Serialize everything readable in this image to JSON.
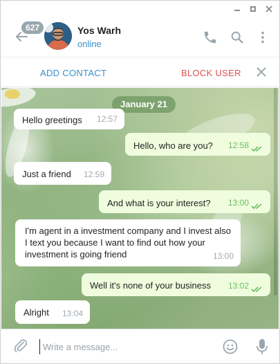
{
  "window": {
    "controls": [
      "minimize",
      "maximize",
      "close"
    ]
  },
  "header": {
    "unread_count": "627",
    "peer_name": "Yos Warh",
    "peer_status": "online",
    "icons": [
      "back-arrow-icon",
      "phone-icon",
      "search-icon",
      "more-vertical-icon"
    ]
  },
  "actions": {
    "add_contact": "ADD CONTACT",
    "block_user": "BLOCK USER"
  },
  "chat": {
    "date": "January 21",
    "messages": [
      {
        "dir": "in",
        "text": "Hello greetings",
        "time": "12:57"
      },
      {
        "dir": "out",
        "text": "Hello, who are you?",
        "time": "12:58",
        "read": true
      },
      {
        "dir": "in",
        "text": "Just a friend",
        "time": "12:59"
      },
      {
        "dir": "out",
        "text": "And what is your interest?",
        "time": "13:00",
        "read": true
      },
      {
        "dir": "in",
        "text": "I'm agent in a investment company and I invest also I text you because I want to find out how your investment is going friend",
        "time": "13:00"
      },
      {
        "dir": "out",
        "text": "Well it's none of your business",
        "time": "13:02",
        "read": true
      },
      {
        "dir": "in",
        "text": "Alright",
        "time": "13:04"
      }
    ]
  },
  "composer": {
    "placeholder": "Write a message...",
    "value": ""
  },
  "colors": {
    "accent": "#3a8ec9",
    "danger": "#d9534f",
    "outgoing_bubble": "#effdde",
    "read_ticks": "#6dbb64"
  }
}
